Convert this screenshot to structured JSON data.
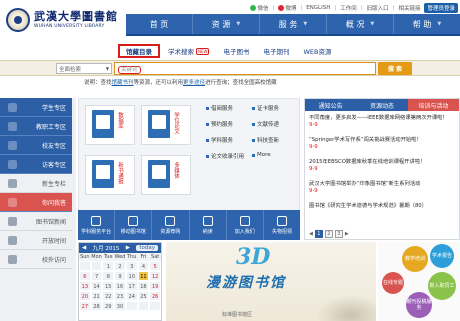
{
  "header": {
    "logo_cn": "武漢大學圖書館",
    "logo_en": "WUHAN UNIVERSITY LIBRARY",
    "util": [
      "微信",
      "微博",
      "ENGLISH",
      "工作间",
      "旧版入口",
      "相关链接"
    ],
    "staff_button": "管理员登录"
  },
  "nav": [
    "首 页",
    "资 源",
    "服 务",
    "概 况",
    "帮 助"
  ],
  "search": {
    "tabs": [
      "馆藏目录",
      "学术搜索",
      "电子图书",
      "电子期刊",
      "WEB资源"
    ],
    "new_badge": "NEW",
    "scope_select": "全面检索",
    "placeholder": "关键词",
    "button": "搜 索",
    "hint_prefix": "说明：查找",
    "hint_link1": "馆藏书刊",
    "hint_mid": "等资源，还可以利用",
    "hint_link2": "更多途径",
    "hint_suffix": "进行查询；查找全国高校馆藏"
  },
  "sidebar": [
    {
      "label": "学生专区",
      "icon": "student-icon"
    },
    {
      "label": "教职工专区",
      "icon": "staff-icon"
    },
    {
      "label": "校友专区",
      "icon": "alumni-icon"
    },
    {
      "label": "访客专区",
      "icon": "visitor-icon"
    },
    {
      "label": "新生专栏",
      "icon": "freshman-icon"
    },
    {
      "label": "你问我答",
      "icon": "qa-icon"
    },
    {
      "label": "图书馆新闻",
      "icon": "news-icon"
    },
    {
      "label": "开放时间",
      "icon": "clock-icon"
    },
    {
      "label": "校外访问",
      "icon": "remote-icon"
    }
  ],
  "tiles": [
    {
      "label": "数据库"
    },
    {
      "label": "学位论文"
    },
    {
      "label": "新书通报"
    },
    {
      "label": "多媒体"
    }
  ],
  "services": [
    "借阅服务",
    "证卡服务",
    "预约服务",
    "文献传递",
    "学科服务",
    "科技查新",
    "论文收录引用",
    "More"
  ],
  "quick_links": [
    "学科服务平台",
    "移动图书馆",
    "资源荐购",
    "纳读",
    "加入我们",
    "失物招领"
  ],
  "calendar": {
    "month_label": "九月 2015",
    "today_label": "today",
    "dow": [
      "Sun",
      "Mon",
      "Tue",
      "Wed",
      "Thu",
      "Fri",
      "Sat"
    ],
    "days": [
      "",
      "",
      "1",
      "2",
      "3",
      "4",
      "5",
      "6",
      "7",
      "8",
      "9",
      "10",
      "11",
      "12",
      "13",
      "14",
      "15",
      "16",
      "17",
      "18",
      "19",
      "20",
      "21",
      "22",
      "23",
      "24",
      "25",
      "26",
      "27",
      "28",
      "29",
      "30",
      "",
      "",
      ""
    ],
    "today_day": "11"
  },
  "banner": {
    "big": "3D",
    "title": "漫游图书馆",
    "caption": "标准图书馆区"
  },
  "news": {
    "tabs": [
      "通知公告",
      "资源动态",
      "培训与活动"
    ],
    "active_tab": 2,
    "items": [
      {
        "text": "不同角度，更多启发——IEEE数据库网络课第两次开课啦！",
        "date": "9-9"
      },
      {
        "text": "“Springer学术写作系”闯关挑战赛活动开始啦！",
        "date": "9-9"
      },
      {
        "text": "2015年EBSCO数据库秋季在线培训课程开讲啦！",
        "date": "9-9"
      },
      {
        "text": "武汉大学图书馆举办“印象图书馆”新生系列活动",
        "date": "9-9"
      },
      {
        "text": "图书馆《研究生学术道德与学术规范》暑期（80）",
        "date": ""
      }
    ],
    "pager": [
      "1",
      "2",
      "3"
    ]
  },
  "bubbles": [
    "教学培训",
    "学术报告",
    "在线专题",
    "新入职员工",
    "期刊投稿服务"
  ]
}
